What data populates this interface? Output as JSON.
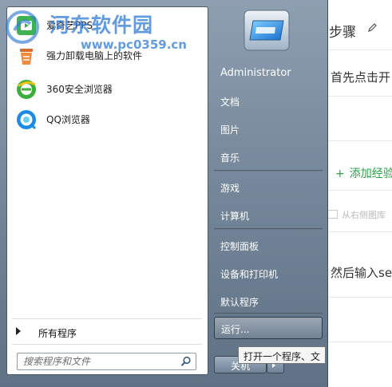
{
  "background_page": {
    "title_fragment": "步骤",
    "line1": "首先点击开",
    "add_experience": "添加经验",
    "image_note": "从右侧图库",
    "line2": "然后输入se"
  },
  "start_menu": {
    "programs": [
      {
        "label": "爱奇艺PPS",
        "icon": "pps-icon"
      },
      {
        "label": "强力卸载电脑上的软件",
        "icon": "uninstall-icon"
      },
      {
        "label": "360安全浏览器",
        "icon": "360-browser-icon"
      },
      {
        "label": "QQ浏览器",
        "icon": "qq-browser-icon"
      }
    ],
    "all_programs": "所有程序",
    "search_placeholder": "搜索程序和文件",
    "right_items": {
      "user": "Administrator",
      "documents": "文档",
      "pictures": "图片",
      "music": "音乐",
      "games": "游戏",
      "computer": "计算机",
      "control_panel": "控制面板",
      "devices_printers": "设备和打印机",
      "default_programs": "默认程序"
    },
    "run": "运行...",
    "shutdown": "关机",
    "tooltip": "打开一个程序、文"
  },
  "watermark": {
    "name": "河东软件园",
    "url": "www.pc0359.cn"
  }
}
